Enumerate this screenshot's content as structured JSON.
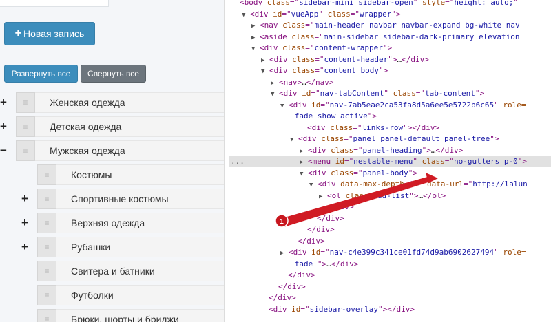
{
  "left_panel": {
    "new_button": "Новая запись",
    "expand_button": "Развернуть все",
    "collapse_button": "Свернуть все",
    "handle_glyph": "≡",
    "tree": [
      {
        "label": "Женская одежда",
        "toggle": "+"
      },
      {
        "label": "Детская одежда",
        "toggle": "+"
      },
      {
        "label": "Мужская одежда",
        "toggle": "−"
      },
      {
        "label": "Костюмы",
        "toggle": ""
      },
      {
        "label": "Спортивные костюмы",
        "toggle": "+"
      },
      {
        "label": "Верхняя одежда",
        "toggle": "+"
      },
      {
        "label": "Рубашки",
        "toggle": "+"
      },
      {
        "label": "Свитера и батники",
        "toggle": ""
      },
      {
        "label": "Футболки",
        "toggle": ""
      },
      {
        "label": "Брюки, шорты и бриджи",
        "toggle": ""
      }
    ]
  },
  "devtools": {
    "selected_marker": "...",
    "badge_number": "1",
    "lines": [
      {
        "indent": 1,
        "arrow": "",
        "text": [
          {
            "k": "tag",
            "v": "<body "
          },
          {
            "k": "an",
            "v": "class"
          },
          {
            "k": "tag",
            "v": "=\""
          },
          {
            "k": "av",
            "v": "sidebar-mini sidebar-open"
          },
          {
            "k": "tag",
            "v": "\" "
          },
          {
            "k": "an",
            "v": "style"
          },
          {
            "k": "tag",
            "v": "=\""
          },
          {
            "k": "av",
            "v": "height: auto;"
          },
          {
            "k": "tag",
            "v": "\""
          }
        ]
      },
      {
        "indent": 2,
        "arrow": "▼",
        "text": [
          {
            "k": "tag",
            "v": "<div "
          },
          {
            "k": "an",
            "v": "id"
          },
          {
            "k": "tag",
            "v": "=\""
          },
          {
            "k": "av",
            "v": "vueApp"
          },
          {
            "k": "tag",
            "v": "\" "
          },
          {
            "k": "an",
            "v": "class"
          },
          {
            "k": "tag",
            "v": "=\""
          },
          {
            "k": "av",
            "v": "wrapper"
          },
          {
            "k": "tag",
            "v": "\">"
          }
        ]
      },
      {
        "indent": 3,
        "arrow": "▶",
        "text": [
          {
            "k": "tag",
            "v": "<nav "
          },
          {
            "k": "an",
            "v": "class"
          },
          {
            "k": "tag",
            "v": "=\""
          },
          {
            "k": "av",
            "v": "main-header navbar navbar-expand bg-white nav"
          },
          {
            "k": "tag",
            "v": ""
          }
        ]
      },
      {
        "indent": 3,
        "arrow": "▶",
        "text": [
          {
            "k": "tag",
            "v": "<aside "
          },
          {
            "k": "an",
            "v": "class"
          },
          {
            "k": "tag",
            "v": "=\""
          },
          {
            "k": "av",
            "v": "main-sidebar sidebar-dark-primary elevation"
          },
          {
            "k": "tag",
            "v": ""
          }
        ]
      },
      {
        "indent": 3,
        "arrow": "▼",
        "text": [
          {
            "k": "tag",
            "v": "<div "
          },
          {
            "k": "an",
            "v": "class"
          },
          {
            "k": "tag",
            "v": "=\""
          },
          {
            "k": "av",
            "v": "content-wrapper"
          },
          {
            "k": "tag",
            "v": "\">"
          }
        ]
      },
      {
        "indent": 4,
        "arrow": "▶",
        "text": [
          {
            "k": "tag",
            "v": "<div "
          },
          {
            "k": "an",
            "v": "class"
          },
          {
            "k": "tag",
            "v": "=\""
          },
          {
            "k": "av",
            "v": "content-header"
          },
          {
            "k": "tag",
            "v": "\">"
          },
          {
            "k": "txt",
            "v": "…"
          },
          {
            "k": "tag",
            "v": "</div>"
          }
        ]
      },
      {
        "indent": 4,
        "arrow": "▼",
        "text": [
          {
            "k": "tag",
            "v": "<div "
          },
          {
            "k": "an",
            "v": "class"
          },
          {
            "k": "tag",
            "v": "=\""
          },
          {
            "k": "av",
            "v": "content body"
          },
          {
            "k": "tag",
            "v": "\">"
          }
        ]
      },
      {
        "indent": 5,
        "arrow": "▶",
        "text": [
          {
            "k": "tag",
            "v": "<nav>"
          },
          {
            "k": "txt",
            "v": "…"
          },
          {
            "k": "tag",
            "v": "</nav>"
          }
        ]
      },
      {
        "indent": 5,
        "arrow": "▼",
        "text": [
          {
            "k": "tag",
            "v": "<div "
          },
          {
            "k": "an",
            "v": "id"
          },
          {
            "k": "tag",
            "v": "=\""
          },
          {
            "k": "av",
            "v": "nav-tabContent"
          },
          {
            "k": "tag",
            "v": "\" "
          },
          {
            "k": "an",
            "v": "class"
          },
          {
            "k": "tag",
            "v": "=\""
          },
          {
            "k": "av",
            "v": "tab-content"
          },
          {
            "k": "tag",
            "v": "\">"
          }
        ]
      },
      {
        "indent": 6,
        "arrow": "▼",
        "text": [
          {
            "k": "tag",
            "v": "<div "
          },
          {
            "k": "an",
            "v": "id"
          },
          {
            "k": "tag",
            "v": "=\""
          },
          {
            "k": "av",
            "v": "nav-7ab5eae2ca53fa8d5a6ee5e5722b6c65"
          },
          {
            "k": "tag",
            "v": "\" "
          },
          {
            "k": "an",
            "v": "role="
          }
        ]
      },
      {
        "indent": 6.7,
        "arrow": "",
        "text": [
          {
            "k": "av",
            "v": "fade show active"
          },
          {
            "k": "tag",
            "v": "\">"
          }
        ]
      },
      {
        "indent": 8,
        "arrow": "",
        "text": [
          {
            "k": "tag",
            "v": "<div "
          },
          {
            "k": "an",
            "v": "class"
          },
          {
            "k": "tag",
            "v": "=\""
          },
          {
            "k": "av",
            "v": "links-row"
          },
          {
            "k": "tag",
            "v": "\"></div>"
          }
        ]
      },
      {
        "indent": 7,
        "arrow": "▼",
        "text": [
          {
            "k": "tag",
            "v": "<div "
          },
          {
            "k": "an",
            "v": "class"
          },
          {
            "k": "tag",
            "v": "=\""
          },
          {
            "k": "av",
            "v": "panel panel-default panel-tree"
          },
          {
            "k": "tag",
            "v": "\">"
          }
        ]
      },
      {
        "indent": 8,
        "arrow": "▶",
        "text": [
          {
            "k": "tag",
            "v": "<div "
          },
          {
            "k": "an",
            "v": "class"
          },
          {
            "k": "tag",
            "v": "=\""
          },
          {
            "k": "av",
            "v": "panel-heading"
          },
          {
            "k": "tag",
            "v": "\">"
          },
          {
            "k": "txt",
            "v": "…"
          },
          {
            "k": "tag",
            "v": "</div>"
          }
        ]
      },
      {
        "indent": 8,
        "arrow": "▶",
        "hl": true,
        "text": [
          {
            "k": "tag",
            "v": "<menu "
          },
          {
            "k": "an",
            "v": "id"
          },
          {
            "k": "tag",
            "v": "=\""
          },
          {
            "k": "av",
            "v": "nestable-menu"
          },
          {
            "k": "tag",
            "v": "\" "
          },
          {
            "k": "an",
            "v": "class"
          },
          {
            "k": "tag",
            "v": "=\""
          },
          {
            "k": "av",
            "v": "no-gutters p-0"
          },
          {
            "k": "tag",
            "v": "\">"
          }
        ]
      },
      {
        "indent": 8,
        "arrow": "▼",
        "text": [
          {
            "k": "tag",
            "v": "<div "
          },
          {
            "k": "an",
            "v": "class"
          },
          {
            "k": "tag",
            "v": "=\""
          },
          {
            "k": "av",
            "v": "panel-body"
          },
          {
            "k": "tag",
            "v": "\">"
          }
        ]
      },
      {
        "indent": 9,
        "arrow": "▼",
        "text": [
          {
            "k": "tag",
            "v": "<div "
          },
          {
            "k": "an",
            "v": "data-max-depth"
          },
          {
            "k": "tag",
            "v": "=\""
          },
          {
            "k": "av",
            "v": "4"
          },
          {
            "k": "tag",
            "v": "\" "
          },
          {
            "k": "an",
            "v": "data-url"
          },
          {
            "k": "tag",
            "v": "=\""
          },
          {
            "k": "av",
            "v": "http://lalun"
          }
        ]
      },
      {
        "indent": 10,
        "arrow": "▶",
        "text": [
          {
            "k": "tag",
            "v": "<ol "
          },
          {
            "k": "an",
            "v": "class"
          },
          {
            "k": "tag",
            "v": "=\""
          },
          {
            "k": "av",
            "v": "dd-list"
          },
          {
            "k": "tag",
            "v": "\">"
          },
          {
            "k": "txt",
            "v": "…"
          },
          {
            "k": "tag",
            "v": "</ol>"
          }
        ]
      },
      {
        "indent": 10,
        "arrow": "",
        "text": [
          {
            "k": "tag",
            "v": "</div>"
          }
        ]
      },
      {
        "indent": 9,
        "arrow": "",
        "text": [
          {
            "k": "tag",
            "v": "</div>"
          }
        ]
      },
      {
        "indent": 8,
        "arrow": "",
        "text": [
          {
            "k": "tag",
            "v": "</div>"
          }
        ]
      },
      {
        "indent": 7,
        "arrow": "",
        "text": [
          {
            "k": "tag",
            "v": "</div>"
          }
        ]
      },
      {
        "indent": 6,
        "arrow": "▶",
        "text": [
          {
            "k": "tag",
            "v": "<div "
          },
          {
            "k": "an",
            "v": "id"
          },
          {
            "k": "tag",
            "v": "=\""
          },
          {
            "k": "av",
            "v": "nav-c4e399c341ce01fd74d9ab6902627494"
          },
          {
            "k": "tag",
            "v": "\" "
          },
          {
            "k": "an",
            "v": "role="
          }
        ]
      },
      {
        "indent": 6.7,
        "arrow": "",
        "text": [
          {
            "k": "av",
            "v": "fade "
          },
          {
            "k": "tag",
            "v": "\">"
          },
          {
            "k": "txt",
            "v": "…"
          },
          {
            "k": "tag",
            "v": "</div>"
          }
        ]
      },
      {
        "indent": 6,
        "arrow": "",
        "text": [
          {
            "k": "tag",
            "v": "</div>"
          }
        ]
      },
      {
        "indent": 5,
        "arrow": "",
        "text": [
          {
            "k": "tag",
            "v": "</div>"
          }
        ]
      },
      {
        "indent": 4,
        "arrow": "",
        "text": [
          {
            "k": "tag",
            "v": "</div>"
          }
        ]
      },
      {
        "indent": 4,
        "arrow": "",
        "text": [
          {
            "k": "tag",
            "v": "<div "
          },
          {
            "k": "an",
            "v": "id"
          },
          {
            "k": "tag",
            "v": "=\""
          },
          {
            "k": "av",
            "v": "sidebar-overlay"
          },
          {
            "k": "tag",
            "v": "\"></div>"
          }
        ]
      }
    ]
  }
}
